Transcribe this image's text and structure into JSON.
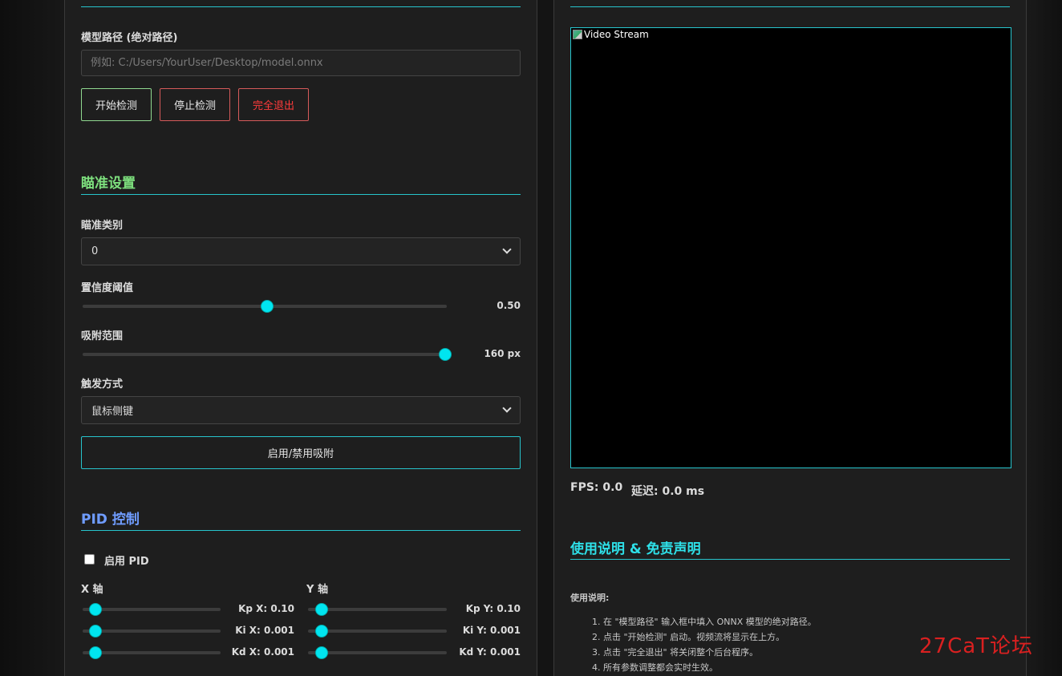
{
  "model_section": {
    "path_label": "模型路径 (绝对路径)",
    "path_placeholder": "例如: C:/Users/YourUser/Desktop/model.onnx",
    "start_button": "开始检测",
    "stop_button": "停止检测",
    "exit_button": "完全退出"
  },
  "aim_section": {
    "heading": "瞄准设置",
    "class_label": "瞄准类别",
    "class_value": "0",
    "confidence_label": "置信度阈值",
    "confidence_value": "0.50",
    "confidence_fraction": 0.5,
    "range_label": "吸附范围",
    "range_value": "160 px",
    "range_fraction": 1.0,
    "trigger_label": "触发方式",
    "trigger_value": "鼠标侧键",
    "toggle_button": "启用/禁用吸附"
  },
  "pid_section": {
    "heading": "PID 控制",
    "enable_label": "启用 PID",
    "x_axis_label": "X 轴",
    "y_axis_label": "Y 轴",
    "kp_x": "Kp X: 0.10",
    "ki_x": "Ki X: 0.001",
    "kd_x": "Kd X: 0.001",
    "kp_y": "Kp Y: 0.10",
    "ki_y": "Ki Y: 0.001",
    "kd_y": "Kd Y: 0.001"
  },
  "video": {
    "alt_text": "Video Stream",
    "fps": "FPS: 0.0",
    "latency": "延迟: 0.0 ms"
  },
  "instructions": {
    "heading": "使用说明 & 免责声明",
    "subtitle": "使用说明:",
    "steps": [
      "1. 在 \"模型路径\" 输入框中填入 ONNX 模型的绝对路径。",
      "2. 点击 \"开始检测\" 启动。视频流将显示在上方。",
      "3. 点击 \"完全退出\" 将关闭整个后台程序。",
      "4. 所有参数调整都会实时生效。"
    ]
  },
  "watermark": "27CaT论坛",
  "colors": {
    "accent": "#27c4cc",
    "aim_heading": "#7ddf7d",
    "pid_heading": "#6f9cff",
    "info_heading": "#2ee0e8",
    "start_border": "#8fd88f",
    "stop_border": "#d65a5a",
    "exit_text": "#ff3b3b"
  }
}
